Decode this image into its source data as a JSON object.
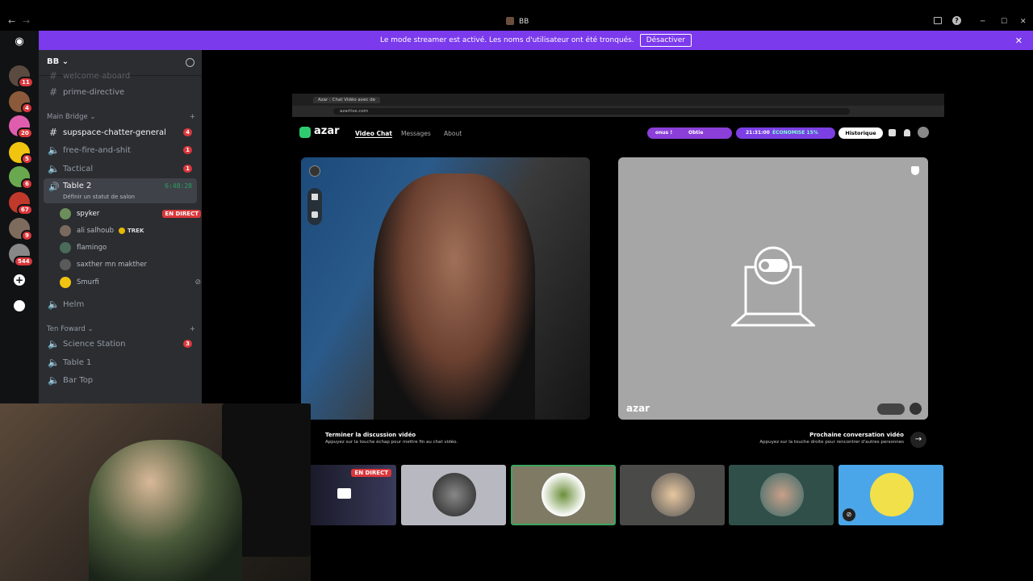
{
  "window": {
    "title": "BB",
    "back": "←",
    "forward": "→",
    "min": "─",
    "max": "☐",
    "close": "✕"
  },
  "streamer_banner": {
    "text": "Le mode streamer est activé. Les noms d'utilisateur ont été tronqués.",
    "button": "Désactiver"
  },
  "server_badges": [
    "11",
    "4",
    "20",
    "5",
    "6",
    "67",
    "9",
    "544"
  ],
  "guild": {
    "name": "BB"
  },
  "channels": {
    "top_cut": "welcome-aboard",
    "prime": "prime-directive",
    "main_bridge": "Main Bridge",
    "general": {
      "name": "supspace-chatter-general",
      "count": "4"
    },
    "ff": {
      "name": "free-fire-and-shit",
      "count": "1"
    },
    "tactical": {
      "name": "Tactical",
      "count": "1"
    },
    "table2": {
      "name": "Table 2",
      "time": "6:48:28",
      "status": "Définir un statut de salon"
    },
    "helm": "Helm",
    "ten_foward": "Ten Foward",
    "science": {
      "name": "Science Station",
      "count": "3"
    },
    "table1": "Table 1",
    "bartop": "Bar Top"
  },
  "voice_users": [
    {
      "name": "spyker",
      "live": "EN DIRECT"
    },
    {
      "name": "ali salhoub",
      "tag": "TREK"
    },
    {
      "name": "flamingo"
    },
    {
      "name": "saxther mn makther"
    },
    {
      "name": "Smurfi"
    }
  ],
  "browser": {
    "tab": "Azar : Chat Vidéo avec de",
    "url": "azarlive.com"
  },
  "azar": {
    "logo": "azar",
    "nav": [
      "Video Chat",
      "Messages",
      "About"
    ],
    "promo": "onus !",
    "promo2": "Obtie",
    "timer": "21:31:00",
    "saving": "ÉCONOMISE 15%",
    "history": "Historique",
    "brand_watermark": "azar",
    "end_title": "Terminer la discussion vidéo",
    "end_sub": "Appuyez sur la touche échap pour mettre fin au chat vidéo.",
    "next_title": "Prochaine conversation vidéo",
    "next_sub": "Appuyez sur la touche droite pour rencontrer d'autres personnes"
  },
  "tiles": {
    "live": "EN DIRECT"
  },
  "colors": {
    "accent": "#7c3aed",
    "live": "#da373c",
    "green": "#23a55a"
  }
}
